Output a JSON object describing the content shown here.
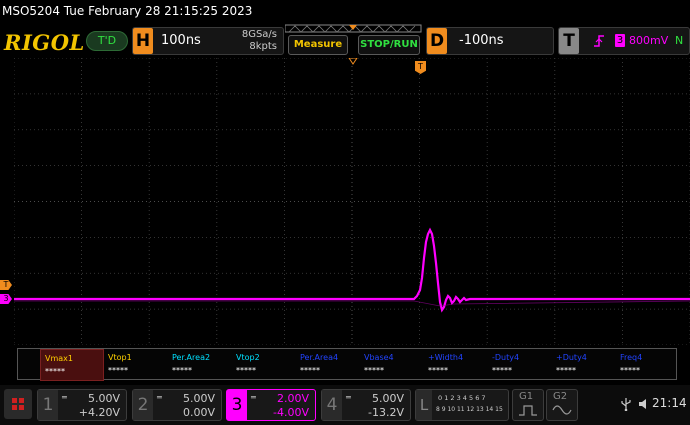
{
  "window": {
    "title": "MSO5204  Tue February 28 21:15:25 2023"
  },
  "brand": {
    "logo": "RIGOL",
    "trigger_mode": "T'D"
  },
  "horizontal": {
    "letter": "H",
    "timebase": "100ns",
    "sample_rate": "8GSa/s",
    "memory_depth": "8kpts"
  },
  "buttons": {
    "measure": "Measure",
    "stop_run": "STOP/RUN"
  },
  "delay": {
    "letter": "D",
    "value": "-100ns"
  },
  "trigger": {
    "letter": "T",
    "source": "3",
    "level": "800mV",
    "coupling_symbol": "N"
  },
  "markers": {
    "trigger_top": "T",
    "trigger_level": "T",
    "channel3": "3"
  },
  "measurements": [
    {
      "name": "Vmax1",
      "value": "*****",
      "color": "#ffd000",
      "selected": true
    },
    {
      "name": "Vtop1",
      "value": "*****",
      "color": "#ffd000"
    },
    {
      "name": "Per.Area2",
      "value": "*****",
      "color": "#00e0ff"
    },
    {
      "name": "Vtop2",
      "value": "*****",
      "color": "#00e0ff"
    },
    {
      "name": "Per.Area4",
      "value": "*****",
      "color": "#2244ff"
    },
    {
      "name": "Vbase4",
      "value": "*****",
      "color": "#2244ff"
    },
    {
      "name": "+Width4",
      "value": "*****",
      "color": "#2244ff"
    },
    {
      "name": "-Duty4",
      "value": "*****",
      "color": "#2244ff"
    },
    {
      "name": "+Duty4",
      "value": "*****",
      "color": "#2244ff"
    },
    {
      "name": "Freq4",
      "value": "*****",
      "color": "#2244ff"
    }
  ],
  "channels": [
    {
      "num": "1",
      "scale": "5.00V",
      "offset": "+4.20V",
      "color": "#ffd000",
      "active": false
    },
    {
      "num": "2",
      "scale": "5.00V",
      "offset": "0.00V",
      "color": "#00e0ff",
      "active": false
    },
    {
      "num": "3",
      "scale": "2.00V",
      "offset": "-4.00V",
      "color": "#ff00ff",
      "active": true
    },
    {
      "num": "4",
      "scale": "5.00V",
      "offset": "-13.2V",
      "color": "#2244ff",
      "active": false
    }
  ],
  "logic": {
    "letter": "L",
    "row1": "0 1 2 3 4 5 6 7",
    "row2": "8 9 10 11 12 13 14 15"
  },
  "generators": {
    "g1": "G1",
    "g2": "G2"
  },
  "status": {
    "time": "21:14"
  },
  "colors": {
    "accent": "#f08c1e",
    "ch3": "#ff00ff",
    "grid": "#4a4a4a"
  }
}
